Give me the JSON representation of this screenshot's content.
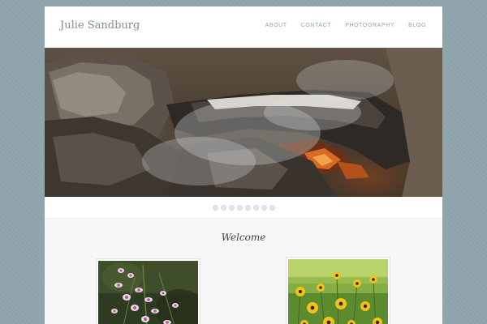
{
  "site": {
    "title": "Julie Sandburg"
  },
  "nav": {
    "items": [
      {
        "label": "ABOUT"
      },
      {
        "label": "CONTACT"
      },
      {
        "label": "PHOTOGRAPHY"
      },
      {
        "label": "BLOG"
      }
    ]
  },
  "slider": {
    "slide_count": 8,
    "active_slide": 1
  },
  "main": {
    "heading": "Welcome"
  },
  "icons": {
    "slider_dot": "circle"
  },
  "colors": {
    "background": "#8ea3ab",
    "title": "#7c8f99",
    "nav": "#8fa6b1",
    "heading": "#444444"
  }
}
